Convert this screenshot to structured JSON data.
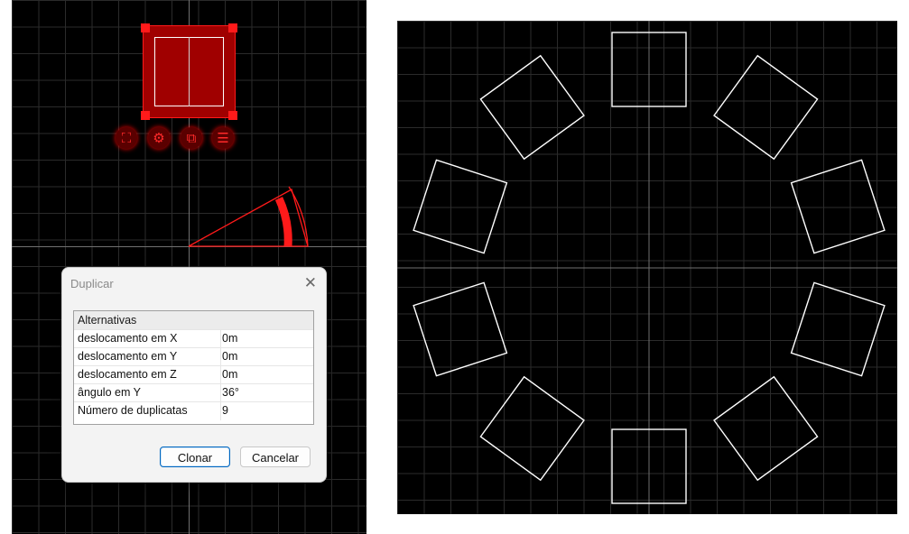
{
  "dialog": {
    "title": "Duplicar",
    "close_glyph": "✕",
    "section_header": "Alternativas",
    "properties": [
      {
        "name": "deslocamento em X",
        "value": "0m"
      },
      {
        "name": "deslocamento em Y",
        "value": "0m"
      },
      {
        "name": "deslocamento em Z",
        "value": "0m"
      },
      {
        "name": "ângulo em Y",
        "value": "36°"
      },
      {
        "name": "Número de duplicatas",
        "value": "9"
      }
    ],
    "confirm_label": "Clonar",
    "cancel_label": "Cancelar"
  },
  "left_viewport": {
    "selection_color": "#a00000",
    "accent_color": "#ff1a1a",
    "tool_icons": [
      "expand-icon",
      "gear-icon",
      "duplicate-icon",
      "list-icon"
    ]
  },
  "right_viewport": {
    "object_count": 10,
    "rotation_step_deg": 36,
    "outline_color": "#ffffff"
  }
}
